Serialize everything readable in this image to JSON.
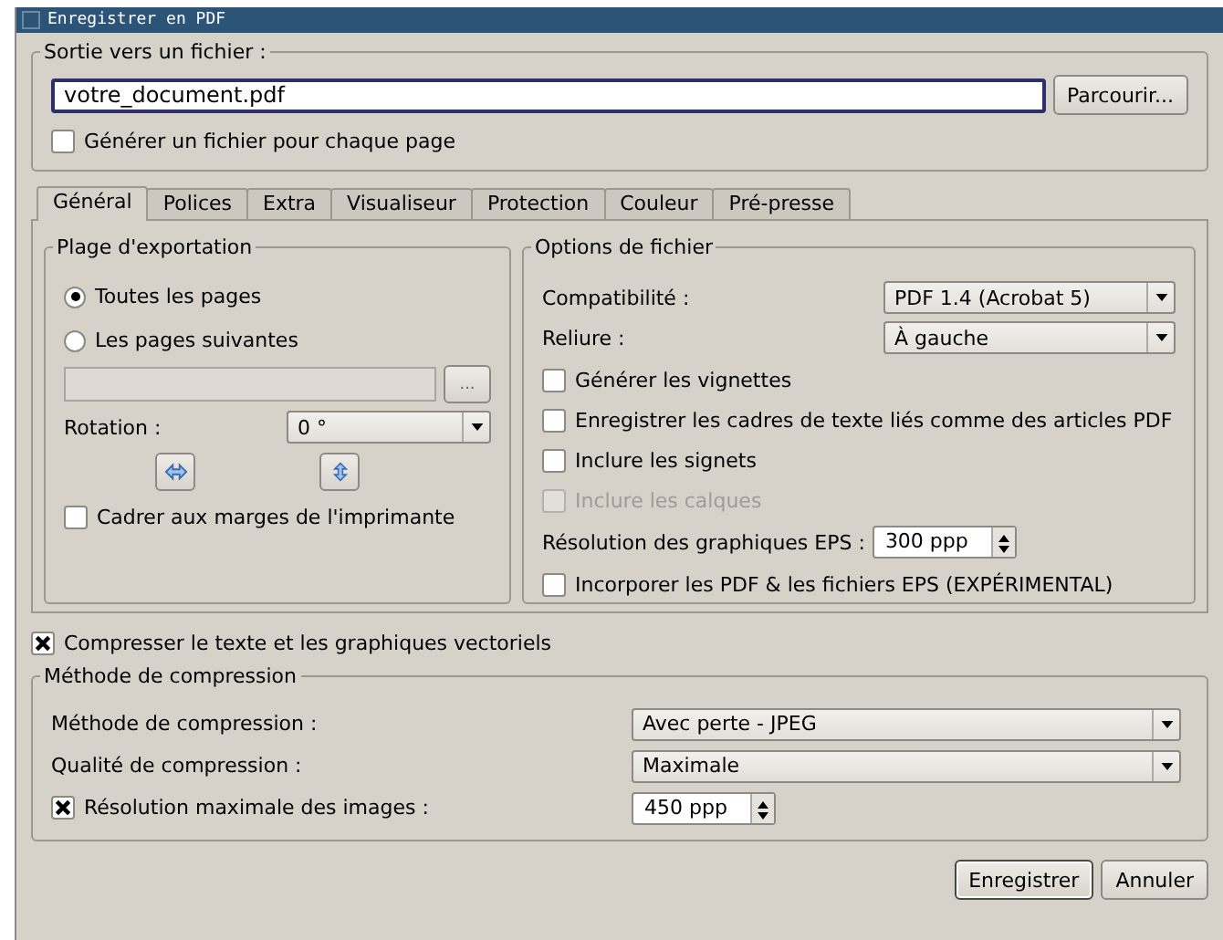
{
  "window": {
    "title": "Enregistrer en PDF"
  },
  "output": {
    "title": "Sortie vers un fichier :",
    "file_value": "votre_document.pdf",
    "browse_button": "Parcourir...",
    "per_page": {
      "label": "Générer un fichier pour chaque page",
      "checked": false
    }
  },
  "tabs": [
    {
      "label": "Général",
      "selected": true
    },
    {
      "label": "Polices",
      "selected": false
    },
    {
      "label": "Extra",
      "selected": false
    },
    {
      "label": "Visualiseur",
      "selected": false
    },
    {
      "label": "Protection",
      "selected": false
    },
    {
      "label": "Couleur",
      "selected": false
    },
    {
      "label": "Pré-presse",
      "selected": false
    }
  ],
  "export_range": {
    "title": "Plage d'exportation",
    "options": [
      {
        "label": "Toutes les pages",
        "selected": true
      },
      {
        "label": "Les pages suivantes",
        "selected": false
      }
    ],
    "pages_field": {
      "disabled": true
    },
    "pages_button": "...",
    "rotation": {
      "label": "Rotation :",
      "value": "0 °"
    },
    "fit_margins": {
      "label": "Cadrer aux marges de l'imprimante",
      "checked": false
    }
  },
  "file_options": {
    "title": "Options de fichier",
    "rows": [
      {
        "kind": "select",
        "label": "Compatibilité :",
        "value": "PDF 1.4 (Acrobat 5)"
      },
      {
        "kind": "select",
        "label": "Reliure :",
        "value": "À gauche"
      },
      {
        "kind": "checkbox",
        "label": "Générer les vignettes",
        "checked": false,
        "disabled": false
      },
      {
        "kind": "checkbox",
        "label": "Enregistrer les cadres de texte liés comme des articles PDF",
        "checked": false,
        "disabled": false
      },
      {
        "kind": "checkbox",
        "label": "Inclure les signets",
        "checked": false,
        "disabled": false
      },
      {
        "kind": "checkbox",
        "label": "Inclure les calques",
        "checked": false,
        "disabled": true
      },
      {
        "kind": "spin",
        "label": "Résolution des graphiques EPS :",
        "value": "300 ppp"
      },
      {
        "kind": "checkbox",
        "label": "Incorporer les PDF & les fichiers EPS (EXPÉRIMENTAL)",
        "checked": false,
        "disabled": false
      }
    ]
  },
  "compress": {
    "label": "Compresser le texte et les graphiques vectoriels",
    "checked": true
  },
  "compression": {
    "title": "Méthode de compression",
    "rows": [
      {
        "kind": "select",
        "label": "Méthode de compression :",
        "value": "Avec perte - JPEG"
      },
      {
        "kind": "select",
        "label": "Qualité de compression :",
        "value": "Maximale"
      },
      {
        "kind": "checkspin",
        "label": "Résolution maximale des images :",
        "checked": true,
        "value": "450 ppp"
      }
    ]
  },
  "buttons": [
    {
      "label": "Enregistrer",
      "default": true
    },
    {
      "label": "Annuler",
      "default": false
    }
  ]
}
